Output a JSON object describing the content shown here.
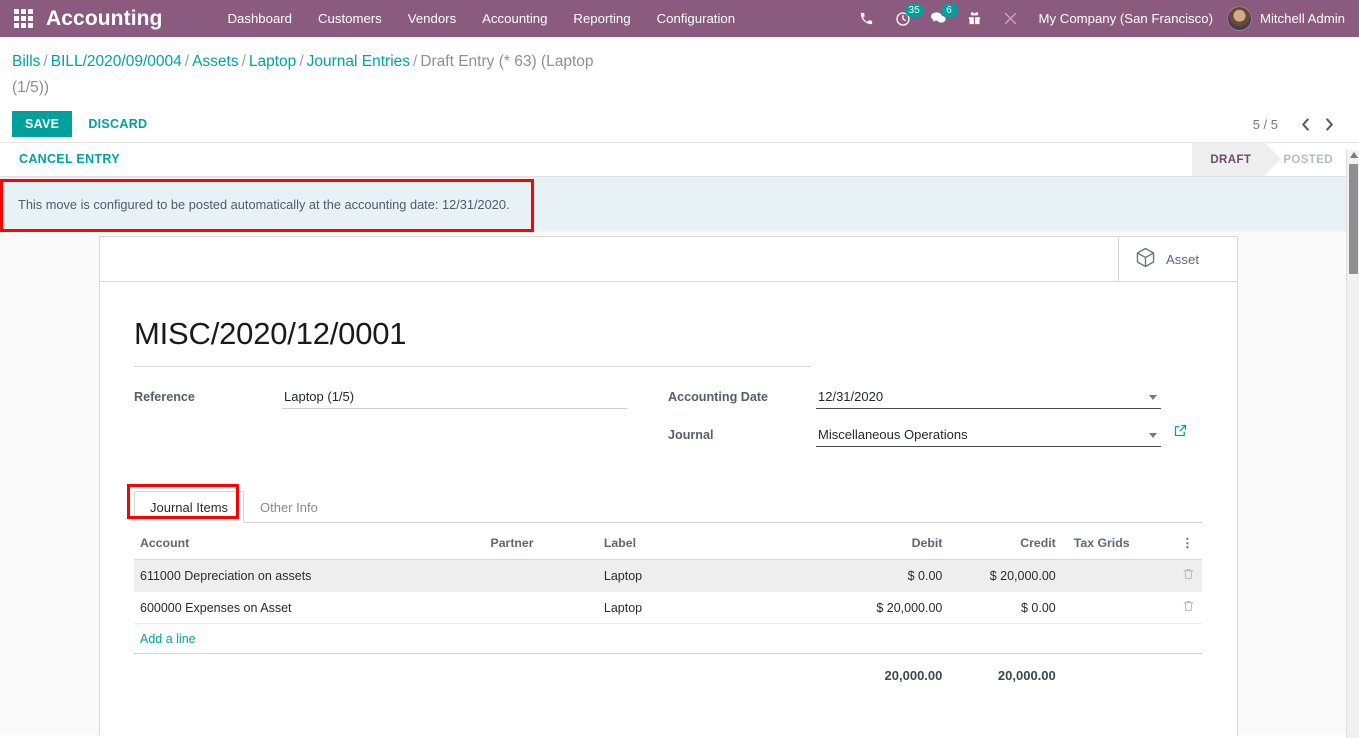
{
  "navbar": {
    "apps_icon": "apps-grid-icon",
    "brand": "Accounting",
    "menu": [
      {
        "label": "Dashboard"
      },
      {
        "label": "Customers"
      },
      {
        "label": "Vendors"
      },
      {
        "label": "Accounting"
      },
      {
        "label": "Reporting"
      },
      {
        "label": "Configuration"
      }
    ],
    "systray": {
      "phone_icon": "phone-icon",
      "activities_icon": "clock-activities-icon",
      "activities_count": "35",
      "messages_icon": "chat-messages-icon",
      "messages_count": "6",
      "gift_icon": "gift-icon",
      "debug_icon": "debug-tools-icon"
    },
    "company": "My Company (San Francisco)",
    "user": "Mitchell Admin",
    "brand_color": "#8b5a7f",
    "badge_color": "#00a09d"
  },
  "breadcrumb": {
    "items": [
      {
        "label": "Bills",
        "current": false
      },
      {
        "label": "BILL/2020/09/0004",
        "current": false
      },
      {
        "label": "Assets",
        "current": false
      },
      {
        "label": "Laptop",
        "current": false
      },
      {
        "label": "Journal Entries",
        "current": false
      },
      {
        "label": "Draft Entry (* 63) (Laptop (1/5))",
        "current": true
      }
    ],
    "separator": "/"
  },
  "actions": {
    "save_label": "SAVE",
    "discard_label": "DISCARD",
    "save_color": "#00a09d"
  },
  "pager": {
    "count": "5 / 5",
    "prev_icon": "chevron-left-icon",
    "next_icon": "chevron-right-icon"
  },
  "statusbar": {
    "cancel_entry_label": "CANCEL ENTRY",
    "states": [
      {
        "label": "DRAFT",
        "active": true
      },
      {
        "label": "POSTED",
        "active": false
      }
    ]
  },
  "alert": {
    "message": "This move is configured to be posted automatically at the accounting date: 12/31/2020.",
    "highlight_color": "#ff0000"
  },
  "smart_buttons": [
    {
      "label": "Asset",
      "icon": "cube-asset-icon"
    }
  ],
  "form": {
    "title": "MISC/2020/12/0001",
    "fields": {
      "reference_label": "Reference",
      "reference_value": "Laptop (1/5)",
      "accounting_date_label": "Accounting Date",
      "accounting_date_value": "12/31/2020",
      "journal_label": "Journal",
      "journal_value": "Miscellaneous Operations",
      "journal_external_icon": "external-link-icon",
      "dropdown_icon": "chevron-down-icon"
    }
  },
  "notebook": {
    "tabs": [
      {
        "label": "Journal Items",
        "active": true
      },
      {
        "label": "Other Info",
        "active": false
      }
    ],
    "highlight_color": "#ff0000"
  },
  "journal_items": {
    "columns": [
      "Account",
      "Partner",
      "Label",
      "Debit",
      "Credit",
      "Tax Grids"
    ],
    "options_icon": "vertical-dots-icon",
    "rows": [
      {
        "account": "611000 Depreciation on assets",
        "partner": "",
        "label": "Laptop",
        "debit": "$ 0.00",
        "credit": "$ 20,000.00",
        "tax_grids": "",
        "delete_icon": "trash-icon",
        "selected": true
      },
      {
        "account": "600000 Expenses on Asset",
        "partner": "",
        "label": "Laptop",
        "debit": "$ 20,000.00",
        "credit": "$ 0.00",
        "tax_grids": "",
        "delete_icon": "trash-icon",
        "selected": false
      }
    ],
    "add_line_label": "Add a line",
    "totals": {
      "debit": "20,000.00",
      "credit": "20,000.00"
    }
  },
  "scrollbar": {
    "up_arrow_icon": "scroll-up-arrow-icon"
  }
}
